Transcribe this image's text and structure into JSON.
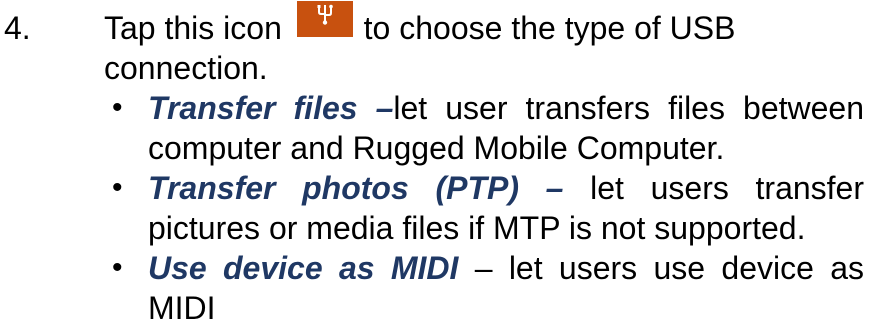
{
  "step": {
    "number": "4.",
    "text_before_icon": "Tap this icon",
    "icon": "usb-icon",
    "icon_color": "#c8510f",
    "text_after_icon": "to choose the type of USB",
    "text_line2": "connection."
  },
  "options": [
    {
      "term": "Transfer files",
      "dash": " –",
      "line1_rest": "let user transfers files between",
      "line2": "computer and Rugged Mobile Computer."
    },
    {
      "term": "Transfer photos (PTP)",
      "dash": " –",
      "line1_rest": " let users transfer",
      "line2": "pictures or media files if MTP is not supported."
    },
    {
      "term": "Use device as MIDI",
      "dash": "",
      "line1_rest": " – let users use device as",
      "line2": "MIDI"
    }
  ],
  "colors": {
    "term_text": "#1f3864",
    "body_text": "#000000"
  }
}
